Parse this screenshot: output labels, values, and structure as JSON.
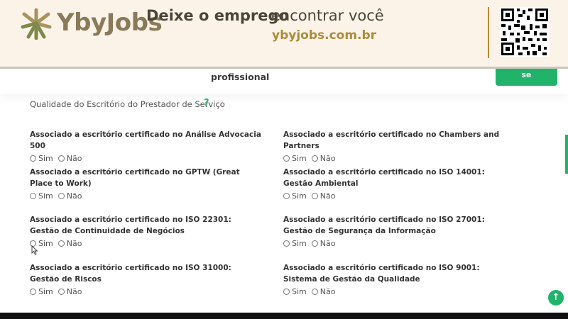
{
  "banner": {
    "logo_text": "YbyJobs",
    "tagline_bold": "Deixe o emprego",
    "tagline_rest": "encontrar você",
    "url": "ybyjobs.com.br"
  },
  "page": {
    "partial_text": "profissional",
    "green_button_label": "se",
    "section_title": "Qualidade do Escritório do Prestador de Serviço",
    "help_glyph": "?",
    "fab_glyph": "↑"
  },
  "questions": [
    {
      "label": "Associado a escritório certificado no Análise Advocacia 500",
      "yes": "Sim",
      "no": "Não"
    },
    {
      "label": "Associado a escritório certificado no Chambers and Partners",
      "yes": "Sim",
      "no": "Não"
    },
    {
      "label": "Associado a escritório certificado no GPTW (Great Place to Work)",
      "yes": "Sim",
      "no": "Não"
    },
    {
      "label": "Associado a escritório certificado no ISO 14001: Gestão Ambiental",
      "yes": "Sim",
      "no": "Não"
    },
    {
      "label": "Associado a escritório certificado no ISO 22301: Gestão de Continuidade de Negócios",
      "yes": "Sim",
      "no": "Não"
    },
    {
      "label": "Associado a escritório certificado no ISO 27001: Gestão de Segurança da Informação",
      "yes": "Sim",
      "no": "Não"
    },
    {
      "label": "Associado a escritório certificado no ISO 31000: Gestão de Riscos",
      "yes": "Sim",
      "no": "Não"
    },
    {
      "label": "Associado a escritório certificado no ISO 9001: Sistema de Gestão da Qualidade",
      "yes": "Sim",
      "no": "Não"
    }
  ],
  "colors": {
    "accent_green": "#22b36b",
    "banner_bg": "#fbf3e8",
    "url_gold": "#b08a3a"
  },
  "icons": {
    "logo": "ybyjobs-logo-icon",
    "qr": "qr-code-icon",
    "help": "question-mark-icon",
    "fab": "arrow-up-icon",
    "cursor": "mouse-cursor-icon"
  }
}
